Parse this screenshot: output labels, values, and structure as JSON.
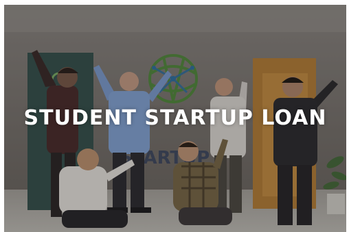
{
  "banner": {
    "headline": "STUDENT STARTUP LOAN",
    "photo_alt": "group-photo-icon",
    "colors": {
      "wall": "#7a7673",
      "floor": "#b9b7b2",
      "logo_green": "#4f8f3a",
      "logo_blue": "#2f74a8",
      "banner_teal": "#2f4a49",
      "banner_orange": "#c98a3a"
    }
  }
}
